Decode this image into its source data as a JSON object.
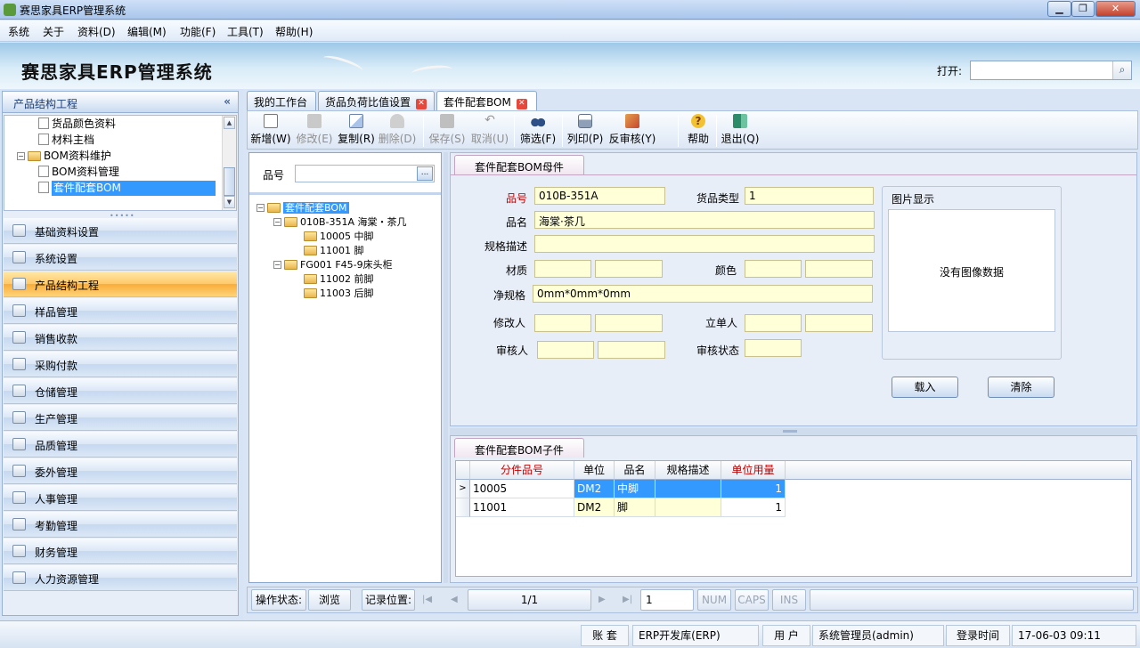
{
  "window": {
    "title": "赛思家具ERP管理系统"
  },
  "menu": [
    "系统",
    "关于",
    "资料(D)",
    "编辑(M)",
    "功能(F)",
    "工具(T)",
    "帮助(H)"
  ],
  "banner": {
    "title": "赛思家具ERP管理系统",
    "open_label": "打开:",
    "open_value": ""
  },
  "left_panel": {
    "header": "产品结构工程",
    "collapse_glyph": "«",
    "tree": [
      {
        "label": "货品颜色资料"
      },
      {
        "label": "材料主档"
      },
      {
        "label": "BOM资料维护"
      },
      {
        "label": "BOM资料管理"
      },
      {
        "label": "套件配套BOM"
      }
    ],
    "nav": [
      {
        "label": "基础资料设置",
        "icon": "list-icon"
      },
      {
        "label": "系统设置",
        "icon": "gear-icon"
      },
      {
        "label": "产品结构工程",
        "icon": "org-chart-icon"
      },
      {
        "label": "样品管理",
        "icon": "org-chart-icon"
      },
      {
        "label": "销售收款",
        "icon": "pen-icon"
      },
      {
        "label": "采购付款",
        "icon": "hand-icon"
      },
      {
        "label": "仓储管理",
        "icon": "house-icon"
      },
      {
        "label": "生产管理",
        "icon": "list-icon"
      },
      {
        "label": "品质管理",
        "icon": "org-chart-icon"
      },
      {
        "label": "委外管理",
        "icon": "org-chart-icon"
      },
      {
        "label": "人事管理",
        "icon": "doc-icon"
      },
      {
        "label": "考勤管理",
        "icon": "org-chart-icon"
      },
      {
        "label": "财务管理",
        "icon": "doc-icon"
      },
      {
        "label": "人力资源管理",
        "icon": "people-icon"
      }
    ]
  },
  "tabs": [
    {
      "label": "我的工作台"
    },
    {
      "label": "货品负荷比值设置"
    },
    {
      "label": "套件配套BOM"
    }
  ],
  "toolbar": [
    {
      "label": "新增(W)",
      "icon": "new-doc-icon"
    },
    {
      "label": "修改(E)",
      "icon": "edit-icon"
    },
    {
      "label": "复制(R)",
      "icon": "copy-icon"
    },
    {
      "label": "删除(D)",
      "icon": "delete-icon"
    },
    {
      "label": "保存(S)",
      "icon": "save-icon"
    },
    {
      "label": "取消(U)",
      "icon": "undo-icon"
    },
    {
      "label": "筛选(F)",
      "icon": "binoculars-icon"
    },
    {
      "label": "列印(P)",
      "icon": "print-icon"
    },
    {
      "label": "反审核(Y)",
      "icon": "unaudit-icon"
    },
    {
      "label": "帮助",
      "icon": "help-icon"
    },
    {
      "label": "退出(Q)",
      "icon": "exit-icon"
    }
  ],
  "search": {
    "label": "品号",
    "value": "",
    "btn": "..."
  },
  "bom_tree": {
    "root": "套件配套BOM",
    "nodes": [
      {
        "label": "010B-351A 海棠・茶几"
      },
      {
        "label": "10005 中脚"
      },
      {
        "label": "11001 脚"
      },
      {
        "label": "FG001 F45-9床头柜"
      },
      {
        "label": "11002 前脚"
      },
      {
        "label": "11003 后脚"
      }
    ],
    "expand_glyph": "−"
  },
  "parent": {
    "tab": "套件配套BOM母件",
    "fields": {
      "pinhao_label": "品号",
      "pinhao": "010B-351A",
      "type_label": "货品类型",
      "type": "1",
      "name_label": "品名",
      "name": "海棠·茶几",
      "spec_label": "规格描述",
      "spec": "",
      "material_label": "材质",
      "material_a": "",
      "material_b": "",
      "color_label": "颜色",
      "color_a": "",
      "color_b": "",
      "net_spec_label": "净规格",
      "net_spec": "0mm*0mm*0mm",
      "modifier_label": "修改人",
      "modifier_a": "",
      "modifier_b": "",
      "creator_label": "立单人",
      "creator_a": "",
      "creator_b": "",
      "auditor_label": "审核人",
      "auditor_a": "",
      "auditor_b": "",
      "audit_status_label": "审核状态",
      "audit_status": ""
    },
    "image": {
      "title": "图片显示",
      "empty": "没有图像数据"
    },
    "load_btn": "载入",
    "clear_btn": "清除"
  },
  "child": {
    "tab": "套件配套BOM子件",
    "columns": [
      "分件品号",
      "单位",
      "品名",
      "规格描述",
      "单位用量"
    ],
    "rows": [
      {
        "marker": ">",
        "part": "10005",
        "unit": "DM2",
        "name": "中脚",
        "spec": "",
        "qty": "1"
      },
      {
        "marker": "",
        "part": "11001",
        "unit": "DM2",
        "name": "脚",
        "spec": "",
        "qty": "1"
      }
    ]
  },
  "status": {
    "op_label": "操作状态:",
    "op_value": "浏览",
    "record_label": "记录位置:",
    "record_value": "1/1",
    "page_input": "1",
    "nav": {
      "first": "|◀",
      "prev": "◀",
      "next": "▶",
      "last": "▶|"
    },
    "num": "NUM",
    "caps": "CAPS",
    "ins": "INS"
  },
  "bottom": {
    "account_label": "账 套",
    "account": "ERP开发库(ERP)",
    "user_label": "用 户",
    "user": "系统管理员(admin)",
    "login_label": "登录时间",
    "login": "17-06-03 09:11"
  },
  "colors": {
    "accent": "#3399ff",
    "active_nav": "#ffc86a",
    "required_label": "#c00000",
    "input_bg": "#ffffd8"
  }
}
